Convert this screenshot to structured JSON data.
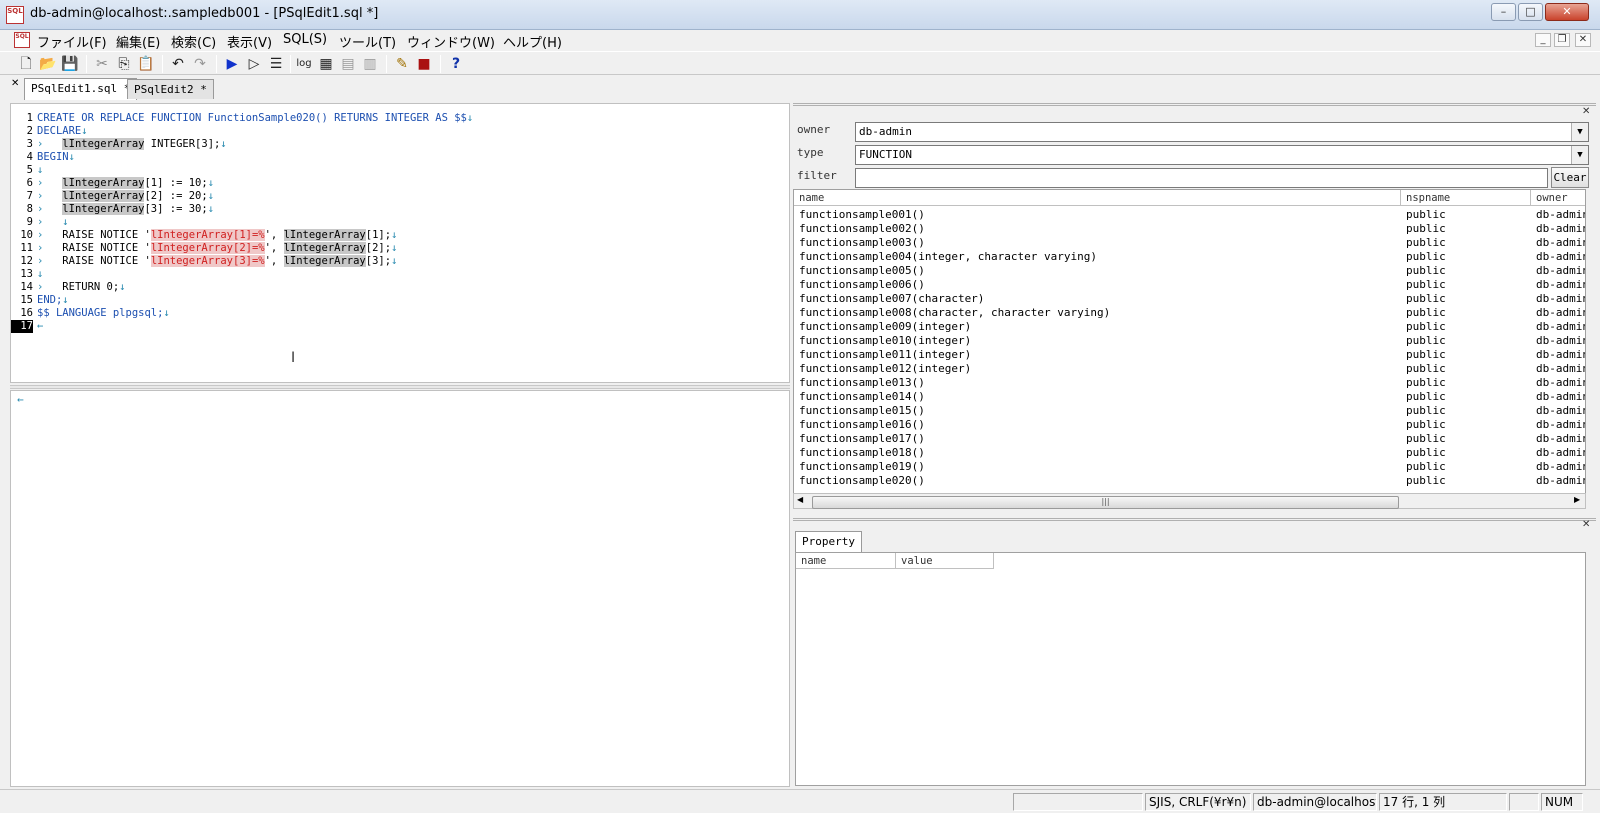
{
  "window": {
    "title": "db-admin@localhost:.sampledb001 - [PSqlEdit1.sql *]",
    "icon": "sql-app-icon"
  },
  "menu": [
    "ファイル(F)",
    "編集(E)",
    "検索(C)",
    "表示(V)",
    "SQL(S)",
    "ツール(T)",
    "ウィンドウ(W)",
    "ヘルプ(H)"
  ],
  "toolbar": {
    "log_label": "log"
  },
  "tabs": [
    {
      "label": "PSqlEdit1.sql *",
      "active": true
    },
    {
      "label": "PSqlEdit2 *",
      "active": false
    }
  ],
  "editor": {
    "current_line": "17",
    "lines": [
      {
        "n": "1",
        "t": "CREATE OR REPLACE FUNCTION FunctionSample020() RETURNS INTEGER AS $$"
      },
      {
        "n": "2",
        "t": "DECLARE"
      },
      {
        "n": "3",
        "t": "lIntegerArray INTEGER[3];"
      },
      {
        "n": "4",
        "t": "BEGIN"
      },
      {
        "n": "5",
        "t": ""
      },
      {
        "n": "6",
        "t": "lIntegerArray[1] := 10;"
      },
      {
        "n": "7",
        "t": "lIntegerArray[2] := 20;"
      },
      {
        "n": "8",
        "t": "lIntegerArray[3] := 30;"
      },
      {
        "n": "9",
        "t": ""
      },
      {
        "n": "10",
        "t": "RAISE NOTICE 'lIntegerArray[1]=%', lIntegerArray[1];"
      },
      {
        "n": "11",
        "t": "RAISE NOTICE 'lIntegerArray[2]=%', lIntegerArray[2];"
      },
      {
        "n": "12",
        "t": "RAISE NOTICE 'lIntegerArray[3]=%', lIntegerArray[3];"
      },
      {
        "n": "13",
        "t": ""
      },
      {
        "n": "14",
        "t": "RETURN 0;"
      },
      {
        "n": "15",
        "t": "END;"
      },
      {
        "n": "16",
        "t": "$$ LANGUAGE plpgsql;"
      },
      {
        "n": "17",
        "t": ""
      }
    ]
  },
  "object_browser": {
    "owner_label": "owner",
    "owner_value": "db-admin",
    "type_label": "type",
    "type_value": "FUNCTION",
    "filter_label": "filter",
    "filter_value": "",
    "clear_label": "Clear",
    "columns": [
      "name",
      "nspname",
      "owner"
    ],
    "rows": [
      [
        "functionsample001()",
        "public",
        "db-admin"
      ],
      [
        "functionsample002()",
        "public",
        "db-admin"
      ],
      [
        "functionsample003()",
        "public",
        "db-admin"
      ],
      [
        "functionsample004(integer, character varying)",
        "public",
        "db-admin"
      ],
      [
        "functionsample005()",
        "public",
        "db-admin"
      ],
      [
        "functionsample006()",
        "public",
        "db-admin"
      ],
      [
        "functionsample007(character)",
        "public",
        "db-admin"
      ],
      [
        "functionsample008(character, character varying)",
        "public",
        "db-admin"
      ],
      [
        "functionsample009(integer)",
        "public",
        "db-admin"
      ],
      [
        "functionsample010(integer)",
        "public",
        "db-admin"
      ],
      [
        "functionsample011(integer)",
        "public",
        "db-admin"
      ],
      [
        "functionsample012(integer)",
        "public",
        "db-admin"
      ],
      [
        "functionsample013()",
        "public",
        "db-admin"
      ],
      [
        "functionsample014()",
        "public",
        "db-admin"
      ],
      [
        "functionsample015()",
        "public",
        "db-admin"
      ],
      [
        "functionsample016()",
        "public",
        "db-admin"
      ],
      [
        "functionsample017()",
        "public",
        "db-admin"
      ],
      [
        "functionsample018()",
        "public",
        "db-admin"
      ],
      [
        "functionsample019()",
        "public",
        "db-admin"
      ],
      [
        "functionsample020()",
        "public",
        "db-admin"
      ]
    ]
  },
  "property": {
    "tab_label": "Property",
    "columns": [
      "name",
      "value"
    ]
  },
  "statusbar": {
    "encoding": "SJIS, CRLF(¥r¥n)",
    "connection": "db-admin@localhost:",
    "position": "17 行, 1 列",
    "num": "NUM"
  }
}
